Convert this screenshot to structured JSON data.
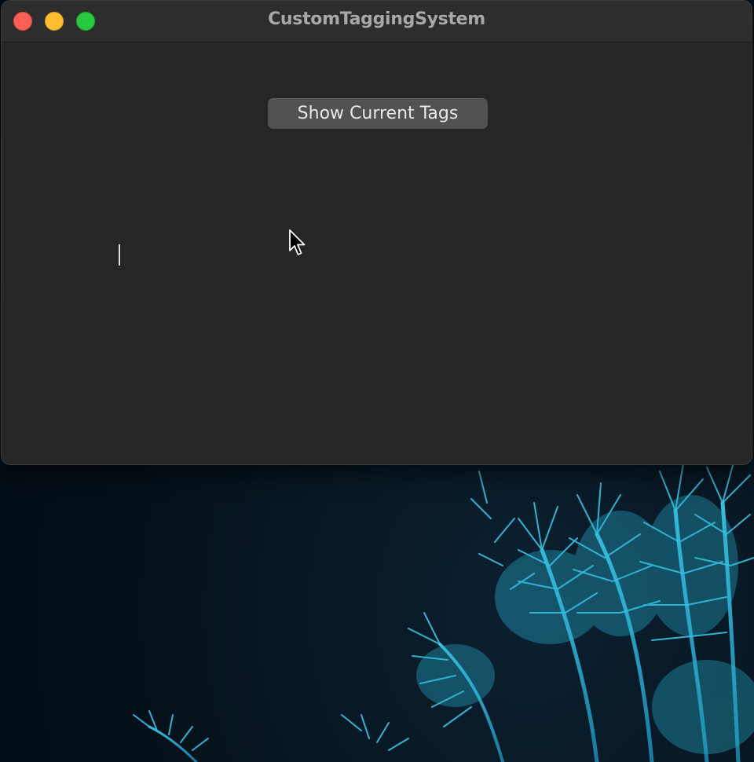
{
  "window": {
    "title": "CustomTaggingSystem",
    "controls": {
      "close_icon": "close-icon",
      "minimize_icon": "minimize-icon",
      "zoom_icon": "zoom-icon"
    }
  },
  "main": {
    "show_tags_button_label": "Show Current Tags"
  },
  "colors": {
    "window_bg": "#262626",
    "titlebar_bg": "#2d2d2d",
    "button_bg": "#525252",
    "close": "#fe5f57",
    "minimize": "#febc2e",
    "zoom": "#28c840",
    "wallpaper_plant": "#2ab6d8"
  },
  "icons": {
    "pointer": "arrow-pointer-icon",
    "caret": "text-caret"
  }
}
